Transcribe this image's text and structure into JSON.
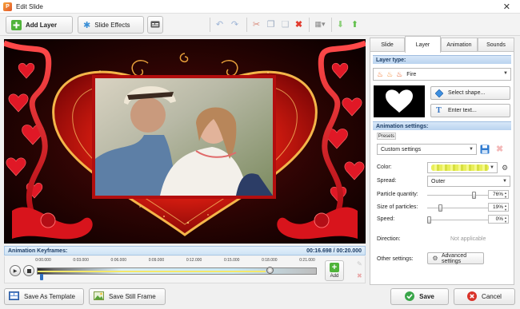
{
  "window": {
    "title": "Edit Slide",
    "close_glyph": "✕"
  },
  "toolbar": {
    "add_layer": "Add Layer",
    "slide_effects": "Slide Effects"
  },
  "keyframes": {
    "label": "Animation Keyframes:",
    "time": "00:16.698 / 00:20.000",
    "ticks": [
      "0:00.000",
      "0:03.000",
      "0:06.000",
      "0:09.000",
      "0:12.000",
      "0:15.000",
      "0:18.000",
      "0:21.000"
    ],
    "progress": 0.83,
    "add_label": "Add"
  },
  "bottom": {
    "save_template": "Save As Template",
    "save_still": "Save Still Frame",
    "save": "Save",
    "cancel": "Cancel"
  },
  "tabs": [
    "Slide",
    "Layer",
    "Animation",
    "Sounds"
  ],
  "active_tab": "Layer",
  "layer": {
    "type_header": "Layer type:",
    "type_value": "Fire",
    "select_shape": "Select shape...",
    "enter_text": "Enter text...",
    "shape_icon": "heart-icon"
  },
  "animation": {
    "header": "Animation settings:",
    "presets_tag": "Presets",
    "preset_value": "Custom settings",
    "color_label": "Color:",
    "spread_label": "Spread:",
    "spread_value": "Outer",
    "particle_quantity_label": "Particle quantity:",
    "particle_quantity_value": "76%",
    "particle_quantity": 0.76,
    "size_label": "Size of particles:",
    "size_value": "19%",
    "size": 0.19,
    "speed_label": "Speed:",
    "speed_value": "0%",
    "speed": 0.0,
    "direction_label": "Direction:",
    "direction_value": "Not applicable",
    "other_label": "Other settings:",
    "advanced": "Advanced settings"
  },
  "colors": {
    "accent": "#2f6fbf",
    "header_blue": "#1c3d66",
    "heart_red": "#d8141c"
  }
}
